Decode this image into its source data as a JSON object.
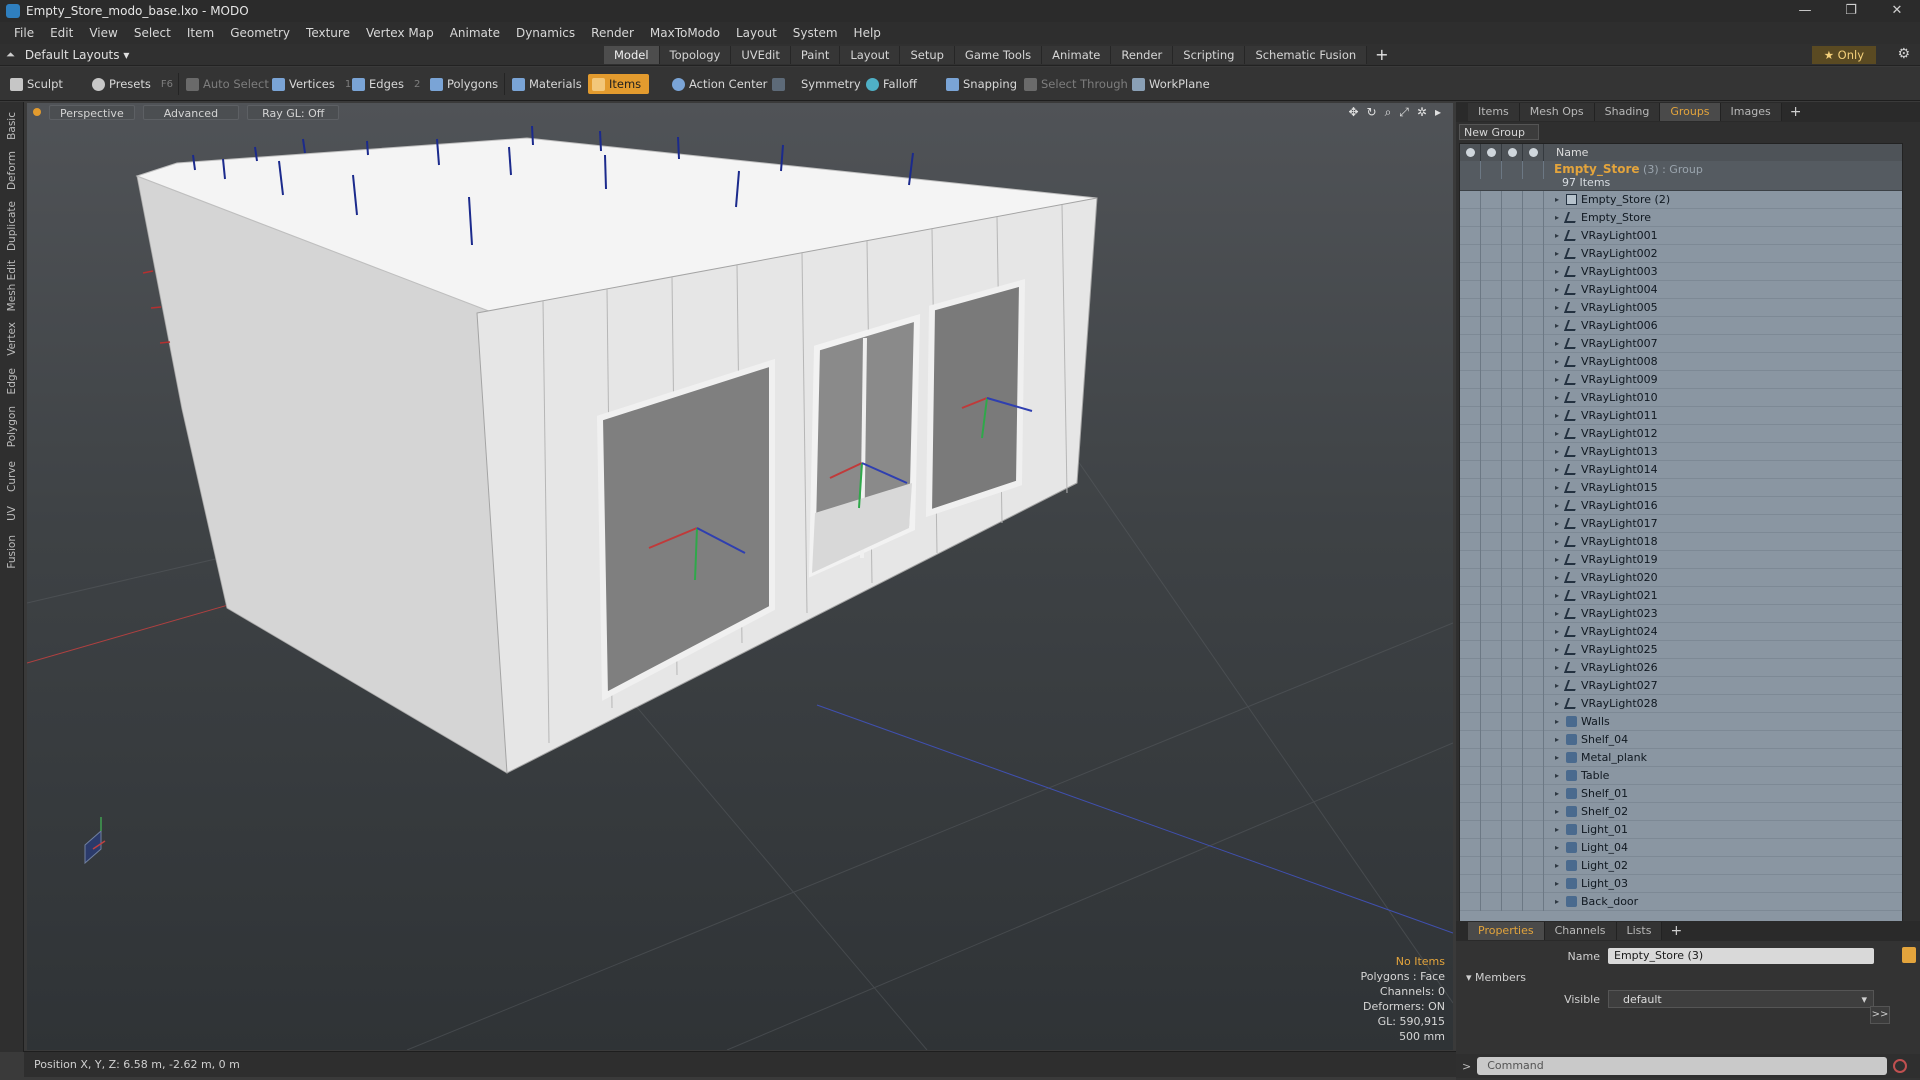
{
  "window": {
    "title": "Empty_Store_modo_base.lxo - MODO",
    "controls": [
      "—",
      "❐",
      "✕"
    ]
  },
  "menubar": [
    "File",
    "Edit",
    "View",
    "Select",
    "Item",
    "Geometry",
    "Texture",
    "Vertex Map",
    "Animate",
    "Dynamics",
    "Render",
    "MaxToModo",
    "Layout",
    "System",
    "Help"
  ],
  "layoutbar": {
    "layouts_label": "Default Layouts ▾",
    "tabs": [
      "Model",
      "Topology",
      "UVEdit",
      "Paint",
      "Layout",
      "Setup",
      "Game Tools",
      "Animate",
      "Render",
      "Scripting",
      "Schematic Fusion"
    ],
    "active_tab": "Model",
    "plus": "+",
    "only_label": "★  Only",
    "gear": "⚙"
  },
  "toolbar": {
    "sculpt": "Sculpt",
    "presets": "Presets",
    "presets_key": "F6",
    "auto_select": "Auto Select",
    "vertices": "Vertices",
    "vertices_key": "1",
    "edges": "Edges",
    "edges_key": "2",
    "polygons": "Polygons",
    "materials": "Materials",
    "items": "Items",
    "action_center": "Action Center",
    "symmetry": "Symmetry",
    "falloff": "Falloff",
    "snapping": "Snapping",
    "select_through": "Select Through",
    "workplane": "WorkPlane"
  },
  "vtabs": [
    "Basic",
    "Deform",
    "Duplicate",
    "Mesh Edit",
    "Vertex",
    "Edge",
    "Polygon",
    "Curve",
    "UV",
    "Fusion"
  ],
  "viewport": {
    "view_label": "Perspective",
    "shading_label": "Advanced",
    "raygl_label": "Ray GL: Off",
    "tool_icons": [
      "✥",
      "↻",
      "⌕",
      "⤢",
      "✲",
      "▸"
    ],
    "info": {
      "selection": "No Items",
      "polygons": "Polygons : Face",
      "channels": "Channels: 0",
      "deformers": "Deformers: ON",
      "gl": "GL: 590,915",
      "grid": "500 mm"
    }
  },
  "statusbar": {
    "position": "Position X, Y, Z:  6.58 m, -2.62 m, 0 m"
  },
  "right_panel": {
    "tabs": [
      "Items",
      "Mesh Ops",
      "Shading",
      "Groups",
      "Images"
    ],
    "active_tab": "Groups",
    "new_group": "New Group",
    "name_header": "Name",
    "group": {
      "name": "Empty_Store",
      "type": " (3) : Group",
      "count": "97 Items"
    },
    "items": [
      {
        "name": "Empty_Store (2)",
        "icon": "group-icon"
      },
      {
        "name": "Empty_Store",
        "icon": "light-icon"
      },
      {
        "name": "VRayLight001",
        "icon": "light-icon"
      },
      {
        "name": "VRayLight002",
        "icon": "light-icon"
      },
      {
        "name": "VRayLight003",
        "icon": "light-icon"
      },
      {
        "name": "VRayLight004",
        "icon": "light-icon"
      },
      {
        "name": "VRayLight005",
        "icon": "light-icon"
      },
      {
        "name": "VRayLight006",
        "icon": "light-icon"
      },
      {
        "name": "VRayLight007",
        "icon": "light-icon"
      },
      {
        "name": "VRayLight008",
        "icon": "light-icon"
      },
      {
        "name": "VRayLight009",
        "icon": "light-icon"
      },
      {
        "name": "VRayLight010",
        "icon": "light-icon"
      },
      {
        "name": "VRayLight011",
        "icon": "light-icon"
      },
      {
        "name": "VRayLight012",
        "icon": "light-icon"
      },
      {
        "name": "VRayLight013",
        "icon": "light-icon"
      },
      {
        "name": "VRayLight014",
        "icon": "light-icon"
      },
      {
        "name": "VRayLight015",
        "icon": "light-icon"
      },
      {
        "name": "VRayLight016",
        "icon": "light-icon"
      },
      {
        "name": "VRayLight017",
        "icon": "light-icon"
      },
      {
        "name": "VRayLight018",
        "icon": "light-icon"
      },
      {
        "name": "VRayLight019",
        "icon": "light-icon"
      },
      {
        "name": "VRayLight020",
        "icon": "light-icon"
      },
      {
        "name": "VRayLight021",
        "icon": "light-icon"
      },
      {
        "name": "VRayLight023",
        "icon": "light-icon"
      },
      {
        "name": "VRayLight024",
        "icon": "light-icon"
      },
      {
        "name": "VRayLight025",
        "icon": "light-icon"
      },
      {
        "name": "VRayLight026",
        "icon": "light-icon"
      },
      {
        "name": "VRayLight027",
        "icon": "light-icon"
      },
      {
        "name": "VRayLight028",
        "icon": "light-icon"
      },
      {
        "name": "Walls",
        "icon": "mesh-icon"
      },
      {
        "name": "Shelf_04",
        "icon": "mesh-icon"
      },
      {
        "name": "Metal_plank",
        "icon": "mesh-icon"
      },
      {
        "name": "Table",
        "icon": "mesh-icon"
      },
      {
        "name": "Shelf_01",
        "icon": "mesh-icon"
      },
      {
        "name": "Shelf_02",
        "icon": "mesh-icon"
      },
      {
        "name": "Light_01",
        "icon": "mesh-icon"
      },
      {
        "name": "Light_04",
        "icon": "mesh-icon"
      },
      {
        "name": "Light_02",
        "icon": "mesh-icon"
      },
      {
        "name": "Light_03",
        "icon": "mesh-icon"
      },
      {
        "name": "Back_door",
        "icon": "mesh-icon"
      }
    ]
  },
  "properties": {
    "tabs": [
      "Properties",
      "Channels",
      "Lists"
    ],
    "active_tab": "Properties",
    "name_label": "Name",
    "name_value": "Empty_Store (3)",
    "members_label": "Members",
    "visible_label": "Visible",
    "visible_value": "default",
    "expand": ">>"
  },
  "command": {
    "placeholder": "Command",
    "arrow": ">"
  },
  "colors": {
    "accent": "#e39b2e",
    "list_bg": "#8a96a2",
    "viewport_top": "#505357"
  }
}
